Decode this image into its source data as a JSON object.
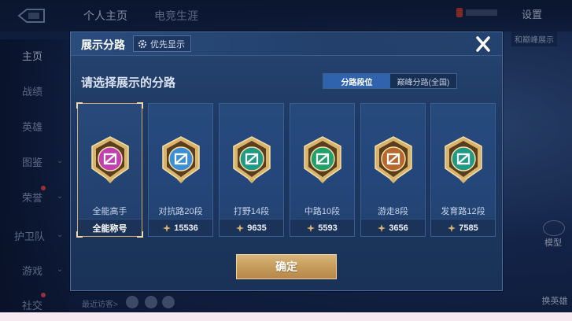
{
  "top_nav": {
    "tabs": [
      "个人主页",
      "电竞生涯"
    ],
    "right_label": "设置"
  },
  "side_nav": {
    "items": [
      "主页",
      "战绩",
      "英雄",
      "图鉴",
      "荣誉",
      "护卫队",
      "游戏",
      "社交"
    ]
  },
  "background": {
    "right_tag": "和巅峰展示",
    "model_label": "模型",
    "swap_label": "换英雄",
    "recent_label": "最近访客>"
  },
  "modal": {
    "title": "展示分路",
    "priority_label": "优先显示",
    "prompt": "请选择展示的分路",
    "toggle": {
      "option_1": "分路段位",
      "option_2": "巅峰分路(全国)",
      "selected": "分路段位"
    },
    "cards": [
      {
        "name": "全能高手",
        "footer_type": "title",
        "footer": "全能称号",
        "selected": true,
        "badge_color": "#c23fb2",
        "badge": "all-round-badge"
      },
      {
        "name": "对抗路20段",
        "footer_type": "score",
        "footer": "15536",
        "selected": false,
        "badge_color": "#3a8fd6",
        "badge": "clash-lane-badge"
      },
      {
        "name": "打野14段",
        "footer_type": "score",
        "footer": "9635",
        "selected": false,
        "badge_color": "#1f9a84",
        "badge": "jungle-badge"
      },
      {
        "name": "中路10段",
        "footer_type": "score",
        "footer": "5593",
        "selected": false,
        "badge_color": "#20a06a",
        "badge": "mid-lane-badge"
      },
      {
        "name": "游走8段",
        "footer_type": "score",
        "footer": "3656",
        "selected": false,
        "badge_color": "#b7682c",
        "badge": "roam-badge"
      },
      {
        "name": "发育路12段",
        "footer_type": "score",
        "footer": "7585",
        "selected": false,
        "badge_color": "#1f9a84",
        "badge": "farm-lane-badge"
      }
    ],
    "confirm_label": "确定"
  },
  "colors": {
    "accent_gold": "#c59a58",
    "toggle_active": "#2f63ad",
    "panel": "#1d3862"
  }
}
